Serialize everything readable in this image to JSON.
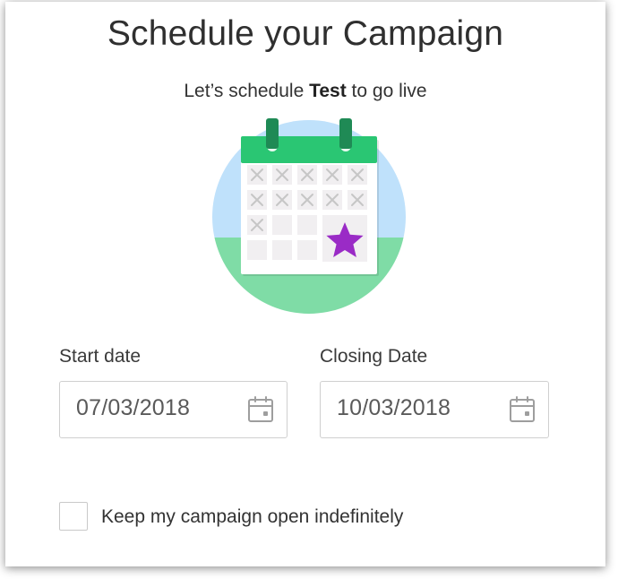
{
  "header": {
    "title": "Schedule your Campaign",
    "subtitle_prefix": "Let’s schedule ",
    "subtitle_campaign": "Test",
    "subtitle_suffix": " to go live"
  },
  "illustration": {
    "icon": "calendar-star-icon",
    "colors": {
      "circle_sky": "#bfe1fb",
      "circle_ground": "#7fdca6",
      "calendar_header": "#2ac673",
      "calendar_rings": "#1f8a55",
      "cell": "#f1eff1",
      "cell_mark": "#c6c6c6",
      "star": "#9a2bc6"
    }
  },
  "form": {
    "start_date": {
      "label": "Start date",
      "value": "07/03/2018",
      "icon": "calendar-icon"
    },
    "closing_date": {
      "label": "Closing Date",
      "value": "10/03/2018",
      "icon": "calendar-icon"
    },
    "keep_open": {
      "label": "Keep my campaign open indefinitely",
      "checked": false
    }
  }
}
